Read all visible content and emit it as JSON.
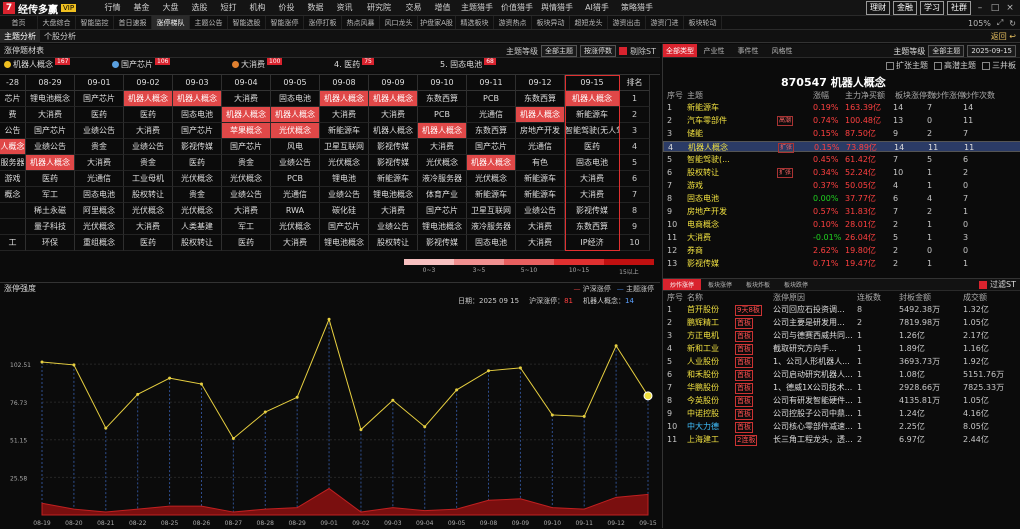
{
  "app": {
    "name": "经传多赢",
    "badge": "VIP",
    "badge2": "顶"
  },
  "menu": [
    "行情",
    "基金",
    "大盘",
    "选股",
    "短打",
    "机构",
    "价投",
    "数据",
    "资讯",
    "研究院",
    "交易",
    "增值",
    "主题猎手",
    "价值猎手",
    "舆情猎手",
    "AI猎手",
    "策略猎手"
  ],
  "topright": {
    "btn1": "理财",
    "btn2": "金融",
    "btn3": "学习",
    "btn4": "社群"
  },
  "tabs": [
    "首页",
    "大盘综合",
    "智能监控",
    "首日速报",
    "涨停梯队",
    "主题公告",
    "智能选股",
    "智能涨停",
    "涨停打板",
    "热点风暴",
    "风口龙头",
    "护盘家A股",
    "精选板块",
    "游资热点",
    "板块异动",
    "超短龙头",
    "游资出击",
    "游资门进",
    "板块轮动"
  ],
  "active_tab": "涨停梯队",
  "tabbar_right": {
    "zoom": "105%"
  },
  "subtabs": [
    "主题分析",
    "个股分析"
  ],
  "back_label": "返回",
  "left_header": {
    "title": "涨停题材表",
    "level_label": "主题等级",
    "level_value": "全部主题",
    "sort_value": "按涨停数",
    "exclude_label": "剔除ST"
  },
  "categories": [
    {
      "label": "机器人概念",
      "count": "167",
      "color": "#f0c020"
    },
    {
      "label": "国产芯片",
      "count": "106",
      "color": "#5aa0e0"
    },
    {
      "label": "大消费",
      "count": "100",
      "color": "#e08030"
    },
    {
      "label": "4. 医药",
      "count": "75",
      "color": ""
    },
    {
      "label": "5. 固态电池",
      "count": "68",
      "color": ""
    }
  ],
  "grid": {
    "headers": [
      "-28",
      "08-29",
      "09-01",
      "09-02",
      "09-03",
      "09-04",
      "09-05",
      "09-08",
      "09-09",
      "09-10",
      "09-11",
      "09-12",
      "09-15",
      "排名"
    ],
    "rows": [
      [
        "芯片",
        "锂电池概念",
        "国产芯片",
        "机器人概念",
        "机器人概念",
        "大消费",
        "固态电池",
        "机器人概念",
        "机器人概念",
        "东数西算",
        "PCB",
        "东数西算",
        "机器人概念",
        "1"
      ],
      [
        "费",
        "大消费",
        "医药",
        "医药",
        "固态电池",
        "机器人概念",
        "机器人概念",
        "大消费",
        "大消费",
        "PCB",
        "光通信",
        "机器人概念",
        "新能源车",
        "2"
      ],
      [
        "公告",
        "国产芯片",
        "业绩公告",
        "大消费",
        "国产芯片",
        "苹果概念",
        "光伏概念",
        "新能源车",
        "机器人概念",
        "机器人概念",
        "东数西算",
        "房地产开发",
        "智能驾驶(无人驾驶)",
        "3"
      ],
      [
        "人概念",
        "业绩公告",
        "贵金",
        "业绩公告",
        "影视传媒",
        "国产芯片",
        "风电",
        "卫星互联网",
        "影视传媒",
        "大消费",
        "国产芯片",
        "光通信",
        "医药",
        "4"
      ],
      [
        "服务器",
        "机器人概念",
        "大消费",
        "贵金",
        "医药",
        "贵金",
        "业绩公告",
        "光伏概念",
        "影视传媒",
        "光伏概念",
        "机器人概念",
        "有色",
        "固态电池",
        "5"
      ],
      [
        "游戏",
        "医药",
        "光通信",
        "工业母机",
        "光伏概念",
        "光伏概念",
        "PCB",
        "锂电池",
        "新能源车",
        "液冷服务器",
        "光伏概念",
        "新能源车",
        "大消费",
        "6"
      ],
      [
        "概念",
        "军工",
        "固态电池",
        "股权转让",
        "贵金",
        "业绩公告",
        "光通信",
        "业绩公告",
        "锂电池概念",
        "体育产业",
        "新能源车",
        "新能源车",
        "大消费",
        "7"
      ],
      [
        "",
        "稀土永磁",
        "阿里概念",
        "光伏概念",
        "光伏概念",
        "大消费",
        "RWA",
        "碳化硅",
        "大消费",
        "国产芯片",
        "卫星互联网",
        "业绩公告",
        "影视传媒",
        "8"
      ],
      [
        "",
        "量子科技",
        "光伏概念",
        "大消费",
        "人类基建",
        "军工",
        "光伏概念",
        "国产芯片",
        "业绩公告",
        "锂电池概念",
        "液冷服务器",
        "大消费",
        "东数西算",
        "9"
      ],
      [
        "工",
        "环保",
        "重组概念",
        "医药",
        "股权转让",
        "医药",
        "大消费",
        "锂电池概念",
        "股权转让",
        "影视传媒",
        "固态电池",
        "大消费",
        "IP经济",
        "10"
      ]
    ],
    "highlights": [
      [
        0,
        3
      ],
      [
        0,
        4
      ],
      [
        0,
        7
      ],
      [
        0,
        8
      ],
      [
        0,
        12
      ],
      [
        1,
        5
      ],
      [
        1,
        6
      ],
      [
        1,
        11
      ],
      [
        2,
        5
      ],
      [
        2,
        6
      ],
      [
        2,
        9
      ],
      [
        3,
        0
      ],
      [
        4,
        1
      ],
      [
        4,
        10
      ]
    ],
    "selected_col": 12
  },
  "heat_legend": [
    {
      "label": "0~3",
      "color": "#f7c0c0"
    },
    {
      "label": "3~5",
      "color": "#f09090"
    },
    {
      "label": "5~10",
      "color": "#e86060"
    },
    {
      "label": "10~15",
      "color": "#e03030"
    },
    {
      "label": "15以上",
      "color": "#c01010"
    }
  ],
  "chart": {
    "title": "涨停强度",
    "legend": [
      {
        "label": "沪深涨停",
        "color": "#e04040"
      },
      {
        "label": "主题涨停",
        "color": "#4080e0"
      }
    ],
    "info": {
      "date_label": "日期：2025 09 15",
      "hs_label": "沪深涨停：",
      "hs_value": "81",
      "theme_label": "机器人概念：",
      "theme_value": "14"
    }
  },
  "chart_data": {
    "type": "line",
    "x": [
      "08-19",
      "08-20",
      "08-21",
      "08-22",
      "08-25",
      "08-26",
      "08-27",
      "08-28",
      "08-29",
      "09-01",
      "09-02",
      "09-03",
      "09-04",
      "09-05",
      "09-08",
      "09-09",
      "09-10",
      "09-11",
      "09-12",
      "09-15"
    ],
    "series": [
      {
        "name": "沪深涨停",
        "values": [
          104,
          102,
          59,
          82,
          93,
          89,
          52,
          70,
          80,
          133,
          58,
          78,
          60,
          85,
          98,
          100,
          68,
          67,
          115,
          81
        ]
      },
      {
        "name": "主题涨停",
        "values": [
          8,
          4,
          2,
          4,
          6,
          6,
          2,
          4,
          5,
          18,
          2,
          5,
          3,
          4,
          10,
          11,
          5,
          4,
          12,
          14
        ]
      }
    ],
    "yticks": [
      "102.51",
      "76.73",
      "51.15",
      "25.58"
    ],
    "ylim": [
      0,
      140
    ]
  },
  "right": {
    "tabs": [
      "全部类型",
      "产业性",
      "事件性",
      "风格性"
    ],
    "level_label": "主题等级",
    "level_value": "全部主题",
    "date_value": "2025-09-15",
    "filters": [
      "扩张主题",
      "高潜主题",
      "三井板"
    ],
    "stock_code": "870547",
    "stock_name": "机器人概念",
    "headers": [
      "序号",
      "主题",
      "涨幅",
      "主力净买额",
      "板块涨停数",
      "炒作涨停",
      "炒作次数"
    ],
    "rows": [
      [
        "1",
        "新能源车",
        "",
        "0.19%",
        "163.39亿",
        "14",
        "7",
        "14"
      ],
      [
        "2",
        "汽车零部件",
        "高潮",
        "0.74%",
        "100.48亿",
        "13",
        "0",
        "11"
      ],
      [
        "3",
        "储能",
        "",
        "0.15%",
        "87.50亿",
        "9",
        "2",
        "7"
      ],
      [
        "4",
        "机器人概念",
        "扩张",
        "0.15%",
        "73.89亿",
        "14",
        "11",
        "11"
      ],
      [
        "5",
        "智能驾驶(...",
        "",
        "0.45%",
        "61.42亿",
        "7",
        "5",
        "6"
      ],
      [
        "6",
        "股权转让",
        "扩张",
        "0.34%",
        "52.24亿",
        "10",
        "1",
        "2"
      ],
      [
        "7",
        "游戏",
        "",
        "0.37%",
        "50.05亿",
        "4",
        "1",
        "0"
      ],
      [
        "8",
        "固态电池",
        "",
        "0.00%",
        "37.77亿",
        "6",
        "4",
        "7"
      ],
      [
        "9",
        "房地产开发",
        "",
        "0.57%",
        "31.83亿",
        "7",
        "2",
        "1"
      ],
      [
        "10",
        "电商概念",
        "",
        "0.10%",
        "28.01亿",
        "2",
        "1",
        "0"
      ],
      [
        "11",
        "大消费",
        "",
        "-0.01%",
        "26.04亿",
        "5",
        "1",
        "3"
      ],
      [
        "12",
        "券商",
        "",
        "2.62%",
        "19.80亿",
        "2",
        "0",
        "0"
      ],
      [
        "13",
        "影视传媒",
        "",
        "0.71%",
        "19.47亿",
        "2",
        "1",
        "1"
      ]
    ],
    "selected_row": 3,
    "z_tabs": [
      "炒作涨停",
      "板块涨停",
      "板块炸板",
      "板块跌停"
    ],
    "z_filter": "过滤ST",
    "z_headers": [
      "序号",
      "名称",
      "",
      "涨停原因",
      "连板数",
      "封板金额",
      "成交额"
    ],
    "z_rows": [
      [
        "1",
        "首开股份",
        "9天8板",
        "公司回应石投资调...",
        "8",
        "5492.38万",
        "1.32亿"
      ],
      [
        "2",
        "鹏辉精工",
        "首板",
        "公司主要是研发用...",
        "2",
        "7819.98万",
        "1.05亿"
      ],
      [
        "3",
        "方正电机",
        "首板",
        "公司与德赛西威共同...",
        "1",
        "1.26亿",
        "2.17亿"
      ],
      [
        "4",
        "新和工业",
        "首板",
        "截取研究方向手...",
        "1",
        "1.89亿",
        "1.16亿"
      ],
      [
        "5",
        "人业股份",
        "首板",
        "1、公司人形机器人...",
        "1",
        "3693.73万",
        "1.92亿"
      ],
      [
        "6",
        "和禾股份",
        "首板",
        "公司启动研究机器人...",
        "1",
        "1.08亿",
        "5151.76万"
      ],
      [
        "7",
        "华鹏股份",
        "首板",
        "1、德威1X公司技术...",
        "1",
        "2928.66万",
        "7825.33万"
      ],
      [
        "8",
        "今英股份",
        "首板",
        "公司有研发智能硬件...",
        "1",
        "4135.81万",
        "1.05亿"
      ],
      [
        "9",
        "中诺控股",
        "首板",
        "公司控股子公司中鼎...",
        "1",
        "1.24亿",
        "4.16亿"
      ],
      [
        "10",
        "中大力德",
        "首板",
        "公司核心零部件减速...",
        "1",
        "2.25亿",
        "8.05亿"
      ],
      [
        "11",
        "上海建工",
        "2连板",
        "长三角工程龙头，透...",
        "2",
        "6.97亿",
        "2.44亿"
      ]
    ]
  }
}
